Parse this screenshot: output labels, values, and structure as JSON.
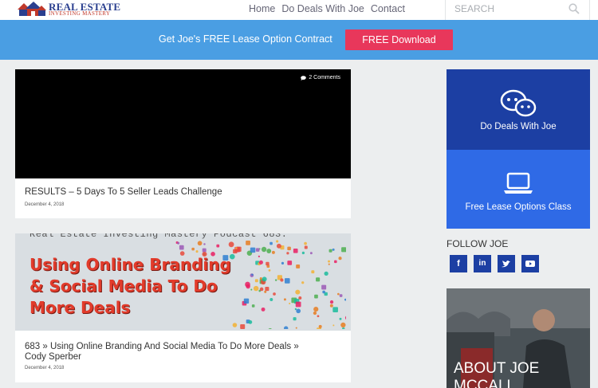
{
  "header": {
    "logo_line1": "REAL ESTATE",
    "logo_line2": "INVESTING MASTERY",
    "nav": [
      "Home",
      "Do Deals With Joe",
      "Contact"
    ],
    "search_placeholder": "SEARCH"
  },
  "banner": {
    "text": "Get Joe's FREE Lease Option Contract",
    "button": "FREE Download",
    "colors": {
      "banner": "#4a9ee3",
      "button": "#e8375b"
    }
  },
  "posts": [
    {
      "comments": "2 Comments",
      "title": "RESULTS – 5 Days To 5 Seller Leads Challenge",
      "date": "December 4, 2018"
    },
    {
      "thumb_top": "Real Estate Investing Mastery Podcast 683:",
      "thumb_lines": [
        "Using Online Branding",
        "& Social Media To Do",
        "More Deals"
      ],
      "title_line1": "683 » Using Online Branding And Social Media To Do More Deals »",
      "title_line2": "Cody Sperber",
      "date": "December 4, 2018"
    }
  ],
  "sidebar": {
    "box1": {
      "label": "Do Deals With Joe",
      "icon": "chat-bubbles-icon",
      "color": "#1c3fa3"
    },
    "box2": {
      "label": "Free Lease Options Class",
      "icon": "laptop-icon",
      "color": "#2f6ae6"
    },
    "follow_title": "FOLLOW JOE",
    "social": [
      {
        "icon": "facebook-icon",
        "glyph": "f"
      },
      {
        "icon": "linkedin-icon",
        "glyph": "in"
      },
      {
        "icon": "twitter-icon",
        "glyph": "t"
      },
      {
        "icon": "youtube-icon",
        "glyph": "▶"
      }
    ],
    "about_line1": "ABOUT JOE",
    "about_line2": "MCCALL"
  }
}
